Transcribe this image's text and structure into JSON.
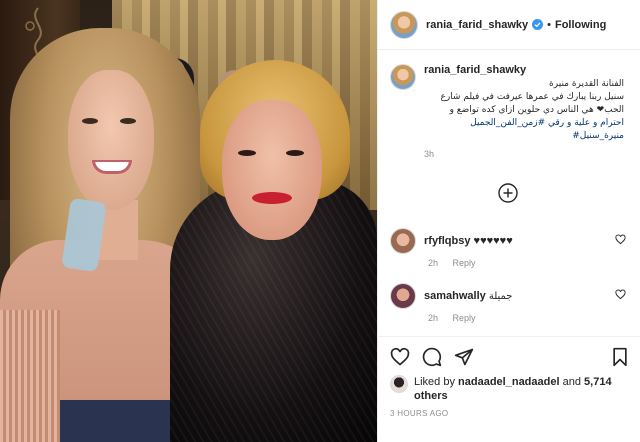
{
  "header": {
    "username": "rania_farid_shawky",
    "separator": "•",
    "follow_status": "Following"
  },
  "caption": {
    "username": "rania_farid_shawky",
    "lines": [
      "الفنانة القديرة منيرة",
      "سنيل ربنا يبارك في عمرها عيرفت في فيلم شارع",
      "الحب❤ هي الناس دي حلوين ازاي كده تواضع و",
      "احترام و علية و رقي #زمن_الفن_الجميل",
      "منيرة_سنيل#"
    ],
    "time": "3h"
  },
  "comments": [
    {
      "username": "rfyflqbsy",
      "text": "♥♥♥♥♥♥",
      "time": "2h",
      "reply": "Reply"
    },
    {
      "username": "samahwally",
      "text": "جميلة",
      "time": "2h",
      "reply": "Reply"
    }
  ],
  "footer": {
    "liked_by_prefix": "Liked by",
    "liked_by_user": "nadaadel_nadaadel",
    "and": "and",
    "others": "5,714 others",
    "posted_ago": "3 HOURS AGO"
  },
  "colors": {
    "accent_link": "#00376b",
    "verified": "#3897f0",
    "muted": "#8e8e8e"
  }
}
